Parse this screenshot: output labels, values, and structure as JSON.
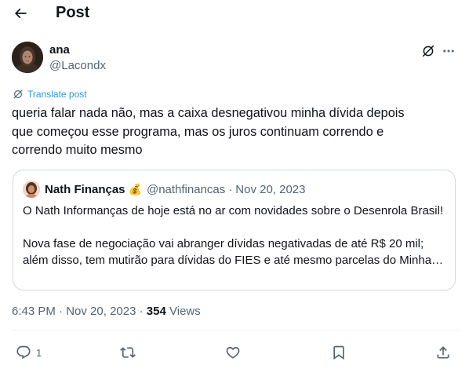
{
  "header": {
    "title": "Post",
    "back_icon": "arrow-left-icon"
  },
  "author": {
    "name": "ana",
    "handle": "@Lacondx"
  },
  "translate": {
    "label": "Translate post"
  },
  "tweet": {
    "lines": [
      "queria falar nada não, mas a caixa desnegativou minha dívida depois",
      "que começou esse programa, mas os juros continuam correndo e",
      "correndo muito mesmo"
    ]
  },
  "quote": {
    "name": "Nath Finanças",
    "emoji": "💰",
    "handle": "@nathfinancas",
    "dot": "·",
    "date": "Nov 20, 2023",
    "paragraph1": "O Nath Informanças de hoje está no ar com novidades sobre o Desenrola Brasil!",
    "paragraph2_line1": "Nova fase de negociação vai abranger dívidas negativadas de até R$ 20 mil;",
    "paragraph2_line2": "além disso, tem mutirão para dívidas do FIES e até mesmo parcelas do Minha…"
  },
  "meta": {
    "time": "6:43 PM",
    "dot": "·",
    "date": "Nov 20, 2023",
    "dot2": "·",
    "views_count": "354",
    "views_label": "Views"
  },
  "actions": {
    "reply_count": "1"
  },
  "colors": {
    "text": "#0f1419",
    "secondary": "#536471",
    "accent": "#1d9bf0",
    "border": "#cfd9de"
  }
}
